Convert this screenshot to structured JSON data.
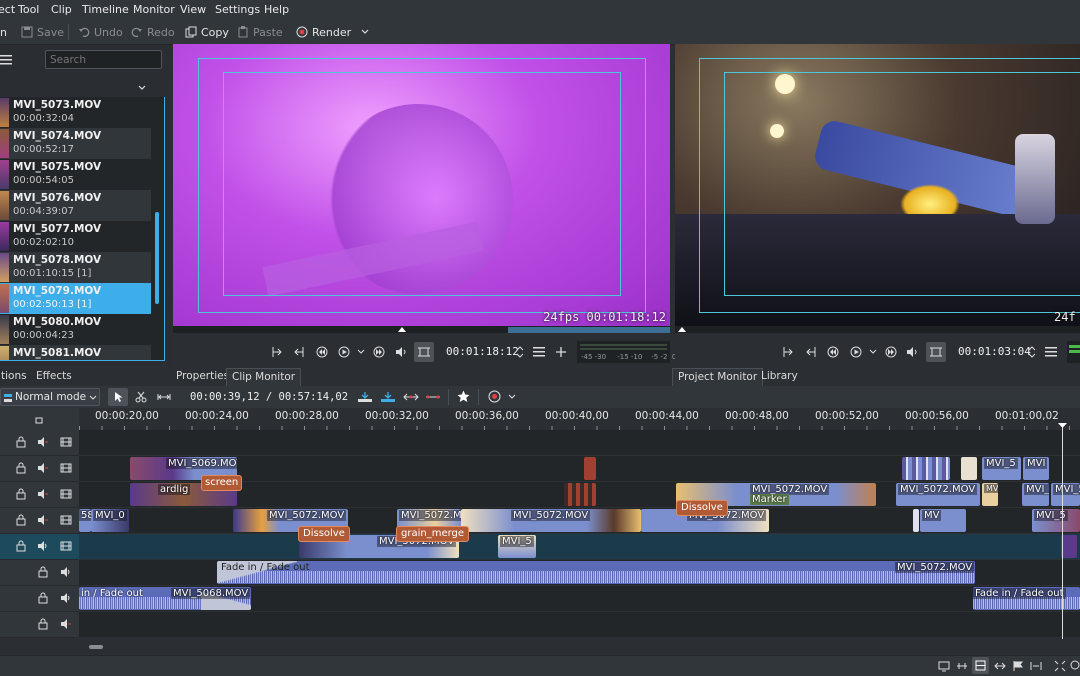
{
  "menu": [
    "ect",
    "Tool",
    "Clip",
    "Timeline",
    "Monitor",
    "View",
    "Settings",
    "Help"
  ],
  "toolbar": {
    "open_label": "n",
    "save_label": "Save",
    "undo_label": "Undo",
    "redo_label": "Redo",
    "copy_label": "Copy",
    "paste_label": "Paste",
    "render_label": "Render"
  },
  "bin": {
    "search_placeholder": "Search",
    "clips": [
      {
        "name": "MVI_5073.MOV",
        "duration": "00:00:32:04"
      },
      {
        "name": "MVI_5074.MOV",
        "duration": "00:00:52:17"
      },
      {
        "name": "MVI_5075.MOV",
        "duration": "00:00:54:05"
      },
      {
        "name": "MVI_5076.MOV",
        "duration": "00:04:39:07"
      },
      {
        "name": "MVI_5077.MOV",
        "duration": "00:02:02:10"
      },
      {
        "name": "MVI_5078.MOV",
        "duration": "00:01:10:15 [1]"
      },
      {
        "name": "MVI_5079.MOV",
        "duration": "00:02:50:13 [1]"
      },
      {
        "name": "MVI_5080.MOV",
        "duration": "00:00:04:23"
      },
      {
        "name": "MVI_5081.MOV",
        "duration": ""
      }
    ]
  },
  "clip_monitor": {
    "overlay": "24fps  00:01:18:12",
    "timecode": "00:01:18:12"
  },
  "project_monitor": {
    "overlay": "24f",
    "timecode": "00:01:03:04",
    "meter": "-45 -30     -15 -10    -5 -2  0"
  },
  "tabs": {
    "left1": "tions",
    "left2": "Effects",
    "properties": "Properties",
    "clip_monitor": "Clip Monitor",
    "project_monitor": "Project Monitor",
    "library": "Library"
  },
  "timeline": {
    "mode": "Normal mode",
    "position": "00:00:39,12 / 00:57:14,02",
    "ruler": [
      "00:00:20,00",
      "00:00:24,00",
      "00:00:28,00",
      "00:00:32,00",
      "00:00:36,00",
      "00:00:40,00",
      "00:00:44,00",
      "00:00:48,00",
      "00:00:52,00",
      "00:00:56,00",
      "00:01:00,02"
    ],
    "clips": {
      "v4a": "MVI_5069.MOV",
      "v4b": "MVI_5",
      "v4c": "MVI",
      "v3a": "ardlig",
      "v3b": "screen",
      "v3c": "MVI_5072.MOV",
      "v3d": "MVI_5072.MOV",
      "v3e": "Marker",
      "v3f": "MVI_5",
      "v3g": "MVI_5",
      "v3h": "MVI_50",
      "v2a": "58",
      "v2b": "MVI_0",
      "v2c": "MVI_5072.MOV",
      "v2d": "MVI_5072.M",
      "v2e": "MVI_5072.MOV",
      "v2f": "MVI_5072.MOV",
      "v2g": "MV",
      "v2h": "MVI_5",
      "v1a": "MVI_5072.MOV",
      "v1b": "MVI_5",
      "a1a": "Fade in / Fade out",
      "a1b": "MVI_5072.MOV",
      "a2a": "in / Fade out",
      "a2b": "MVI_5068.MOV",
      "a2c": "Fade in / Fade out"
    },
    "transitions": {
      "t1": "Dissolve",
      "t2": "grain_merge",
      "t3": "Dissolve"
    }
  },
  "colors": {
    "accent": "#3daee9",
    "clip_video": "#7b8fce",
    "clip_audio": "#5c6bb7",
    "transition": "#b05a36"
  }
}
